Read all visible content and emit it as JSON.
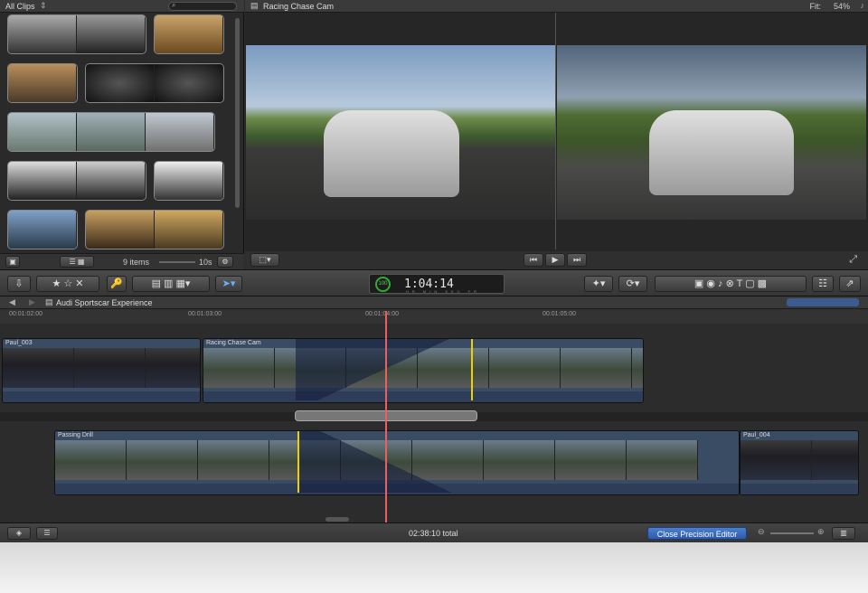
{
  "browser": {
    "title": "All Clips",
    "items_count": "9 items",
    "duration": "10s"
  },
  "viewer": {
    "title": "Racing Chase Cam",
    "fit_label": "Fit:",
    "zoom": "54%"
  },
  "toolbar": {
    "timecode_ring": "100",
    "timecode": "1:04:14",
    "timecode_units": "HR MIN SEC FR"
  },
  "timeline": {
    "project_title": "Audi Sportscar Experience",
    "ruler_ticks": [
      "00:01:02:00",
      "00:01:03:00",
      "00:01:04:00",
      "00:01:05:00"
    ],
    "clips": {
      "top_left": "Paul_003",
      "top_right": "Racing Chase Cam",
      "bottom_left": "Passing Drill",
      "bottom_right": "Paul_004"
    }
  },
  "footer": {
    "total": "02:38:10 total",
    "close_precision": "Close Precision Editor"
  },
  "colors": {
    "accent": "#2d5aa8",
    "playhead": "#e86060",
    "selection": "#f0d000"
  }
}
